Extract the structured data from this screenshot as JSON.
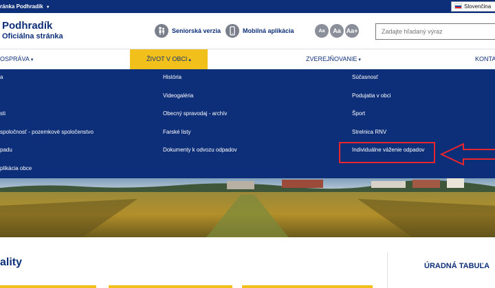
{
  "topbar": {
    "site_label": "ránka Podhradík",
    "language": "Slovenčina"
  },
  "header": {
    "title": "Podhradík",
    "subtitle": "Oficiálna stránka",
    "senior_label": "Seniorská verzia",
    "mobile_label": "Mobilná aplikácia",
    "font_buttons": [
      "Aa",
      "Aa",
      "Aa+"
    ],
    "search_placeholder": "Zadajte hľadaný výraz"
  },
  "nav": {
    "items": [
      {
        "label": "OSPRÁVA",
        "chevron": "▾"
      },
      {
        "label": "ŽIVOT V OBCI",
        "chevron": "▴",
        "active": true
      },
      {
        "label": "ZVEREJŇOVANIE",
        "chevron": "▾"
      },
      {
        "label": "KONTA",
        "chevron": ""
      }
    ]
  },
  "mega_menu": {
    "col1": [
      "a",
      "sti",
      "spoločnosť - pozemkové spoločenstvo",
      "padu",
      "plikácia obce"
    ],
    "col2": [
      "História",
      "Videogaléria",
      "Obecný spravodaj - archív",
      "Farské listy",
      "Dokumenty k odvozu odpadov"
    ],
    "col3": [
      "Súčasnosť",
      "Podujatia v obci",
      "Šport",
      "Strelnica RNV",
      "Individuálne váženie odpadov"
    ]
  },
  "content": {
    "aktuality_label": "ality",
    "uradna_label": "ÚRADNÁ TABUĽA"
  },
  "colors": {
    "brand_navy": "#0d2f7a",
    "accent_yellow": "#f2c01a",
    "annotation_red": "#e8262b"
  }
}
